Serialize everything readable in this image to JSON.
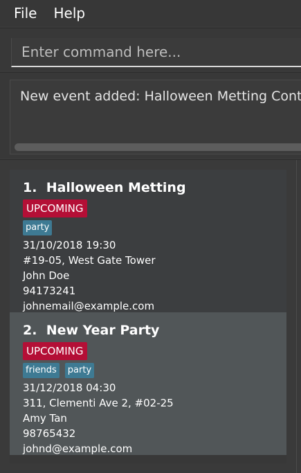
{
  "menu": {
    "file": "File",
    "help": "Help"
  },
  "command": {
    "placeholder": "Enter command here..."
  },
  "result": {
    "text": "New event added: Halloween Metting Contact: John Doe"
  },
  "events": [
    {
      "index": "1.",
      "name": "Halloween Metting",
      "status": "UPCOMING",
      "tags": [
        "party"
      ],
      "datetime": "31/10/2018 19:30",
      "venue": "#19-05, West Gate Tower",
      "contact": "John Doe",
      "phone": "94173241",
      "email": "johnemail@example.com"
    },
    {
      "index": "2.",
      "name": "New Year Party",
      "status": "UPCOMING",
      "tags": [
        "friends",
        "party"
      ],
      "datetime": "31/12/2018 04:30",
      "venue": "311, Clementi Ave 2, #02-25",
      "contact": "Amy Tan",
      "phone": "98765432",
      "email": "johnd@example.com"
    }
  ],
  "colors": {
    "background": "#3a3a3a",
    "status_upcoming": "#b40f36",
    "tag": "#3e7a93",
    "selected_card": "#515658"
  }
}
